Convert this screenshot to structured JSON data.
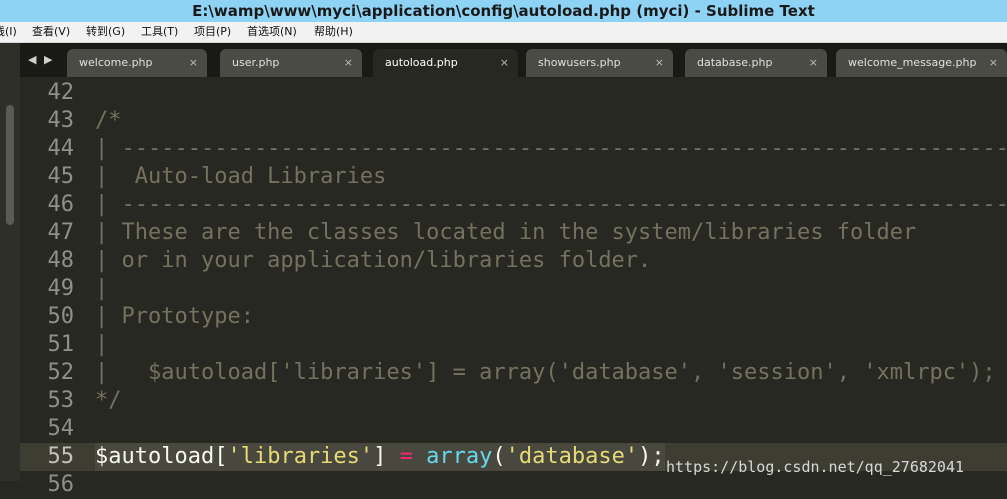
{
  "window": {
    "title": "E:\\wamp\\www\\myci\\application\\config\\autoload.php (myci) - Sublime Text"
  },
  "menu": {
    "items": [
      {
        "label": "线(I)"
      },
      {
        "label": "查看(V)"
      },
      {
        "label": "转到(G)"
      },
      {
        "label": "工具(T)"
      },
      {
        "label": "项目(P)"
      },
      {
        "label": "首选项(N)"
      },
      {
        "label": "帮助(H)"
      }
    ]
  },
  "tabs": {
    "nav": "◀ ▶",
    "items": [
      {
        "label": "welcome.php",
        "close": "×"
      },
      {
        "label": "user.php",
        "close": "×"
      },
      {
        "label": "autoload.php",
        "close": "×",
        "active": true
      },
      {
        "label": "showusers.php",
        "close": "×"
      },
      {
        "label": "database.php",
        "close": "×"
      },
      {
        "label": "welcome_message.php",
        "close": "×"
      }
    ]
  },
  "editor": {
    "lines": [
      {
        "num": "42",
        "text": ""
      },
      {
        "num": "43",
        "text": "/*"
      },
      {
        "num": "44",
        "text": "| -------------------------------------------------------------------"
      },
      {
        "num": "45",
        "text": "|  Auto-load Libraries"
      },
      {
        "num": "46",
        "text": "| -------------------------------------------------------------------"
      },
      {
        "num": "47",
        "text": "| These are the classes located in the system/libraries folder"
      },
      {
        "num": "48",
        "text": "| or in your application/libraries folder."
      },
      {
        "num": "49",
        "text": "|"
      },
      {
        "num": "50",
        "text": "| Prototype:"
      },
      {
        "num": "51",
        "text": "|"
      },
      {
        "num": "52",
        "text": "|   $autoload['libraries'] = array('database', 'session', 'xmlrpc');"
      },
      {
        "num": "53",
        "text": "*/"
      },
      {
        "num": "54",
        "text": ""
      },
      {
        "num": "55",
        "current": true
      },
      {
        "num": "56",
        "text": ""
      }
    ],
    "current_line_tokens": {
      "t1": "$autoload",
      "t2": "[",
      "t3": "'libraries'",
      "t4": "] ",
      "t5": "=",
      "t6": " ",
      "t7": "array",
      "t8": "(",
      "t9": "'database'",
      "t10": ");"
    }
  },
  "watermark": "https://blog.csdn.net/qq_27682041"
}
